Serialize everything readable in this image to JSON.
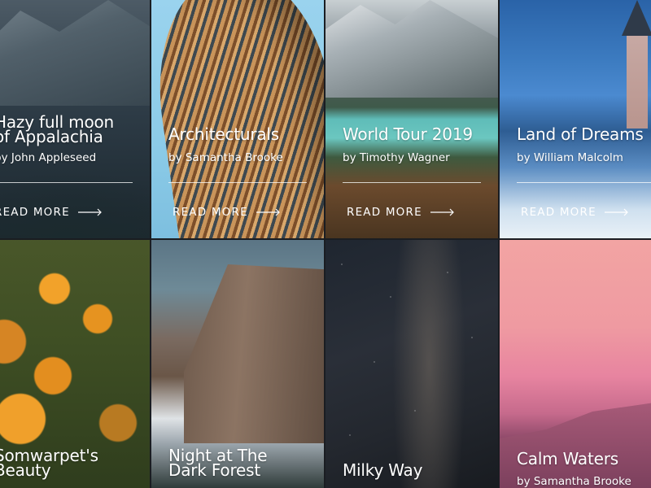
{
  "cards": [
    {
      "title": "Hazy full moon\nof Appalachia",
      "author": "by John Appleseed",
      "read_more": "READ MORE"
    },
    {
      "title": "Architecturals",
      "author": "by Samantha Brooke",
      "read_more": "READ MORE"
    },
    {
      "title": "World Tour 2019",
      "author": "by Timothy Wagner",
      "read_more": "READ MORE"
    },
    {
      "title": "Land of Dreams",
      "author": "by William Malcolm",
      "read_more": "READ MORE"
    },
    {
      "title": "Somwarpet's\nBeauty"
    },
    {
      "title": "Night at The\nDark Forest"
    },
    {
      "title": "Milky Way"
    },
    {
      "title": "Calm Waters",
      "author": "by Samantha Brooke"
    }
  ],
  "icons": {
    "read_more_arrow": "arrow-right-icon"
  },
  "colors": {
    "text": "#ffffff",
    "divider": "rgba(255,255,255,0.75)"
  }
}
